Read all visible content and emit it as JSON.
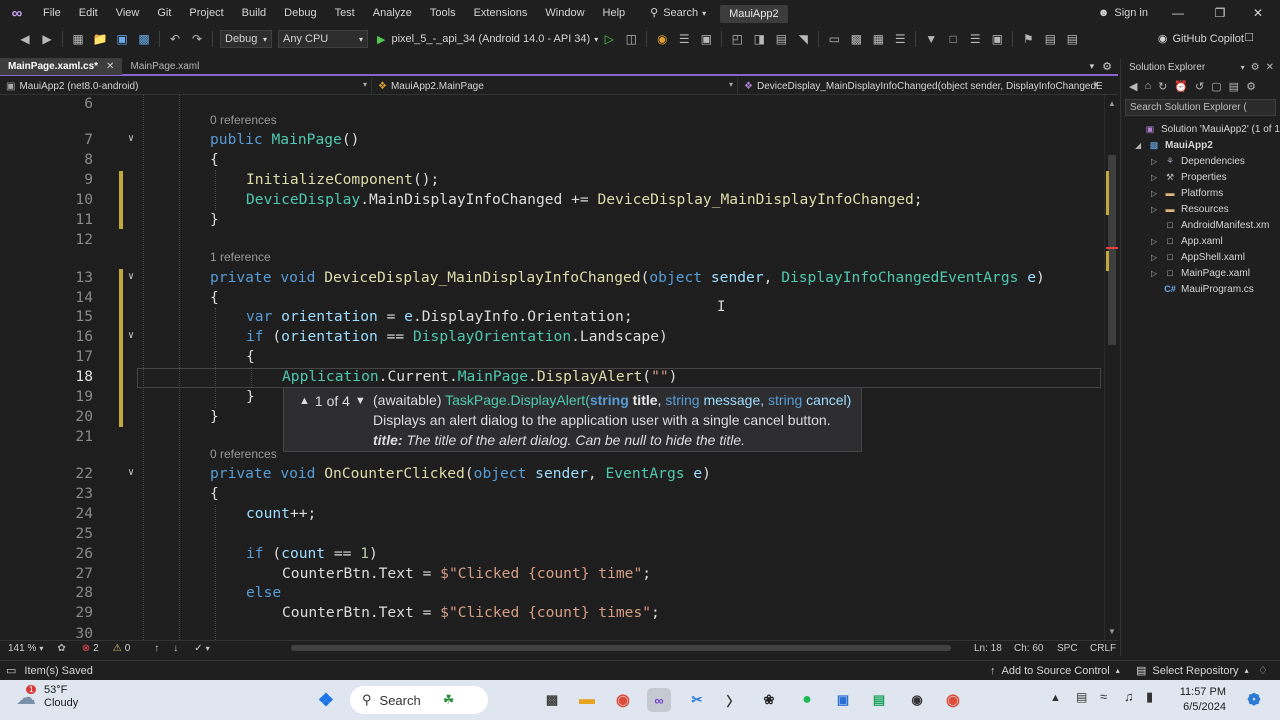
{
  "menu": {
    "items": [
      "File",
      "Edit",
      "View",
      "Git",
      "Project",
      "Build",
      "Debug",
      "Test",
      "Analyze",
      "Tools",
      "Extensions",
      "Window",
      "Help"
    ],
    "search_label": "Search",
    "solution_name": "MauiApp2",
    "sign_in": "Sign in"
  },
  "toolbar": {
    "configuration": "Debug",
    "platform": "Any CPU",
    "run_target": "pixel_5_-_api_34 (Android 14.0 - API 34)",
    "copilot": "GitHub Copilot"
  },
  "tabs": [
    {
      "label": "MainPage.xaml.cs*",
      "active": true
    },
    {
      "label": "MainPage.xaml",
      "active": false
    }
  ],
  "navbar": {
    "project": "MauiApp2 (net8.0-android)",
    "type": "MauiApp2.MainPage",
    "member": "DeviceDisplay_MainDisplayInfoChanged(object sender, DisplayInfoChangedEventArgs e)"
  },
  "editor": {
    "line_numbers": [
      "6",
      "7",
      "8",
      "9",
      "10",
      "11",
      "12",
      "13",
      "14",
      "15",
      "16",
      "17",
      "18",
      "19",
      "20",
      "21",
      "22",
      "23",
      "24",
      "25",
      "26",
      "27",
      "28",
      "29",
      "30"
    ],
    "current_line": "18",
    "references": {
      "main_page": "0 references",
      "display_changed": "1 reference",
      "counter_clicked": "0 references"
    },
    "code": {
      "l7": "public MainPage()",
      "l8": "{",
      "l9": "InitializeComponent();",
      "l10": "DeviceDisplay.MainDisplayInfoChanged += DeviceDisplay_MainDisplayInfoChanged;",
      "l11": "}",
      "l13": "private void DeviceDisplay_MainDisplayInfoChanged(object sender, DisplayInfoChangedEventArgs e)",
      "l14": "{",
      "l15": "var orientation = e.DisplayInfo.Orientation;",
      "l16": "if (orientation == DisplayOrientation.Landscape)",
      "l17": "{",
      "l18": "Application.Current.MainPage.DisplayAlert(\"\")",
      "l19": "}",
      "l20": "}",
      "l22": "private void OnCounterClicked(object sender, EventArgs e)",
      "l23": "{",
      "l24": "count++;",
      "l26": "if (count == 1)",
      "l27": "CounterBtn.Text = $\"Clicked {count} time\";",
      "l28": "else",
      "l29": "CounterBtn.Text = $\"Clicked {count} times\";"
    }
  },
  "signature_help": {
    "counter": "1 of 4",
    "prefix": "(awaitable)",
    "return_type": "Task",
    "method": "Page.DisplayAlert(",
    "p1_type": "string",
    "p1_name": "title",
    "p2_type": "string",
    "p2_name": "message,",
    "p3_type": "string",
    "p3_name": "cancel)",
    "description": "Displays an alert dialog to the application user with a single cancel button.",
    "param_label": "title:",
    "param_description": "The title of the alert dialog. Can be null to hide the title."
  },
  "editor_status": {
    "zoom": "141 %",
    "errors": "2",
    "warnings": "0",
    "line": "Ln: 18",
    "col": "Ch: 60",
    "whitespace": "SPC",
    "eol": "CRLF"
  },
  "solution_explorer": {
    "title": "Solution Explorer",
    "search_placeholder": "Search Solution Explorer (",
    "items": [
      {
        "label": "Solution 'MauiApp2' (1 of 1",
        "level": 0,
        "icon": "solution-icon"
      },
      {
        "label": "MauiApp2",
        "level": 1,
        "icon": "csharp-project-icon",
        "bold": true
      },
      {
        "label": "Dependencies",
        "level": 2,
        "icon": "dependencies-icon"
      },
      {
        "label": "Properties",
        "level": 2,
        "icon": "wrench-icon"
      },
      {
        "label": "Platforms",
        "level": 2,
        "icon": "folder-icon"
      },
      {
        "label": "Resources",
        "level": 2,
        "icon": "folder-icon"
      },
      {
        "label": "AndroidManifest.xm",
        "level": 2,
        "icon": "file-icon"
      },
      {
        "label": "App.xaml",
        "level": 2,
        "icon": "xaml-file-icon"
      },
      {
        "label": "AppShell.xaml",
        "level": 2,
        "icon": "xaml-file-icon"
      },
      {
        "label": "MainPage.xaml",
        "level": 2,
        "icon": "xaml-file-icon"
      },
      {
        "label": "MauiProgram.cs",
        "level": 2,
        "icon": "csharp-file-icon"
      }
    ]
  },
  "statusbar": {
    "message": "Item(s) Saved",
    "source_control": "Add to Source Control",
    "repository": "Select Repository"
  },
  "taskbar": {
    "temperature": "53°F",
    "condition": "Cloudy",
    "weather_badge": "1",
    "search": "Search",
    "time": "11:57 PM",
    "date": "6/5/2024"
  },
  "colors": {
    "accent": "#8a63d2",
    "keyword": "#569cd6",
    "type": "#4ec9b0",
    "method": "#dcdcaa",
    "string": "#d69d85"
  }
}
